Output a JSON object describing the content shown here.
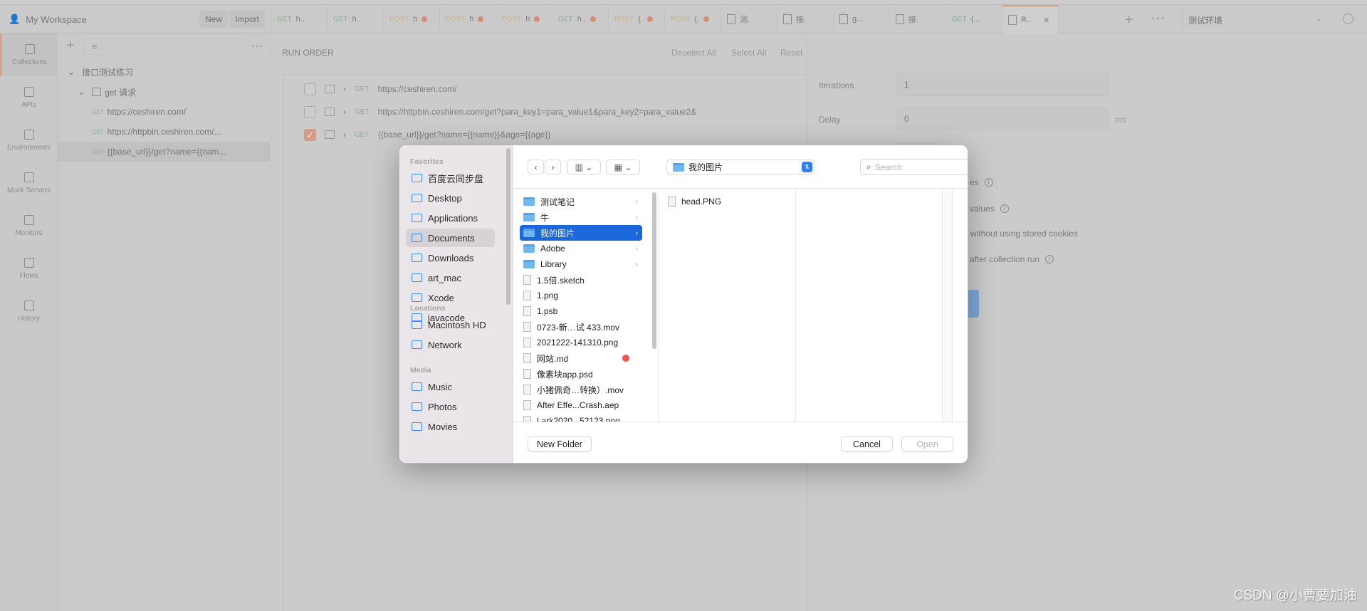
{
  "header": {
    "workspace": "My Workspace",
    "new_label": "New",
    "import_label": "Import",
    "environment": "测试环境",
    "tabs": [
      {
        "method": "GET",
        "label": "h..",
        "dot": false,
        "icon": ""
      },
      {
        "method": "GET",
        "label": "h..",
        "dot": false,
        "icon": ""
      },
      {
        "method": "POST",
        "label": "h",
        "dot": true,
        "icon": ""
      },
      {
        "method": "POST",
        "label": "h",
        "dot": true,
        "icon": ""
      },
      {
        "method": "POST",
        "label": "h",
        "dot": true,
        "icon": ""
      },
      {
        "method": "GET",
        "label": "h..",
        "dot": true,
        "icon": ""
      },
      {
        "method": "POST",
        "label": "{.",
        "dot": true,
        "icon": ""
      },
      {
        "method": "POST",
        "label": "{.",
        "dot": true,
        "icon": ""
      },
      {
        "method": "",
        "label": "测.",
        "dot": false,
        "icon": "environment-icon"
      },
      {
        "method": "",
        "label": "接.",
        "dot": false,
        "icon": "collection-icon"
      },
      {
        "method": "",
        "label": "g...",
        "dot": false,
        "icon": "folder-icon"
      },
      {
        "method": "",
        "label": "接.",
        "dot": false,
        "icon": "runner-icon"
      },
      {
        "method": "GET",
        "label": "{...",
        "dot": false,
        "icon": ""
      },
      {
        "method": "",
        "label": "R...",
        "dot": false,
        "icon": "runner-icon",
        "active": true
      }
    ]
  },
  "rail": [
    {
      "label": "Collections",
      "icon": "collections-icon",
      "active": true
    },
    {
      "label": "APIs",
      "icon": "apis-icon"
    },
    {
      "label": "Environments",
      "icon": "environments-icon"
    },
    {
      "label": "Mock Servers",
      "icon": "mock-servers-icon"
    },
    {
      "label": "Monitors",
      "icon": "monitors-icon"
    },
    {
      "label": "Flows",
      "icon": "flows-icon"
    },
    {
      "label": "History",
      "icon": "history-icon"
    }
  ],
  "tree": {
    "collection": "接口测试练习",
    "folder": "get 请求",
    "requests": [
      {
        "method": "GET",
        "label": "https://ceshiren.com/"
      },
      {
        "method": "GET",
        "label": "https://httpbin.ceshiren.com/..."
      },
      {
        "method": "GET",
        "label": "{{base_url}}/get?name={{nam..."
      }
    ]
  },
  "run": {
    "title": "RUN ORDER",
    "deselect_all": "Deselect All",
    "select_all": "Select All",
    "reset": "Reset",
    "rows": [
      {
        "checked": false,
        "method": "GET",
        "url": "https://ceshiren.com/"
      },
      {
        "checked": false,
        "method": "GET",
        "url": "https://httpbin.ceshiren.com/get?para_key1=para_value1&para_key2=para_value2&"
      },
      {
        "checked": true,
        "method": "GET",
        "url": "{{base_url}}/get?name={{name}}&age={{age}}"
      }
    ]
  },
  "settings": {
    "iterations_label": "Iterations",
    "iterations": "1",
    "delay_label": "Delay",
    "delay": "0",
    "delay_unit": "ms",
    "options": [
      "es",
      "values",
      "without using stored cookies",
      "after collection run"
    ]
  },
  "dialog": {
    "favorites_label": "Favorites",
    "locations_label": "Locations",
    "media_label": "Media",
    "favorites": [
      {
        "label": "百度云同步盘",
        "icon": "folder-icon"
      },
      {
        "label": "Desktop",
        "icon": "desktop-icon"
      },
      {
        "label": "Applications",
        "icon": "applications-icon"
      },
      {
        "label": "Documents",
        "icon": "document-icon",
        "selected": true
      },
      {
        "label": "Downloads",
        "icon": "downloads-icon"
      },
      {
        "label": "art_mac",
        "icon": "home-icon"
      },
      {
        "label": "Xcode",
        "icon": "folder-icon"
      },
      {
        "label": "javacode",
        "icon": "folder-icon"
      }
    ],
    "locations": [
      {
        "label": "Macintosh HD",
        "icon": "disk-icon"
      },
      {
        "label": "Network",
        "icon": "network-icon"
      }
    ],
    "media": [
      {
        "label": "Music",
        "icon": "music-icon"
      },
      {
        "label": "Photos",
        "icon": "photos-icon"
      },
      {
        "label": "Movies",
        "icon": "movies-icon"
      }
    ],
    "path": "我的图片",
    "search_placeholder": "Search",
    "column1": [
      {
        "name": "测试笔记",
        "folder": true
      },
      {
        "name": "牛",
        "folder": true
      },
      {
        "name": "我的图片",
        "folder": true,
        "selected": true
      },
      {
        "name": "Adobe",
        "folder": true
      },
      {
        "name": "Library",
        "folder": true
      },
      {
        "name": "1.5倍.sketch"
      },
      {
        "name": "1.png"
      },
      {
        "name": "1.psb"
      },
      {
        "name": "0723-新…试 433.mov"
      },
      {
        "name": "2021222-141310.png"
      },
      {
        "name": "网站.md",
        "tag": "#f45452"
      },
      {
        "name": "像素块app.psd"
      },
      {
        "name": "小猪佩奇…转换）.mov"
      },
      {
        "name": "After Effe...Crash.aep"
      },
      {
        "name": "Lark2020...52123.png"
      }
    ],
    "column2": [
      {
        "name": "head.PNG"
      }
    ],
    "new_folder": "New Folder",
    "cancel": "Cancel",
    "open": "Open"
  },
  "watermark": "CSDN @小曹要加油"
}
